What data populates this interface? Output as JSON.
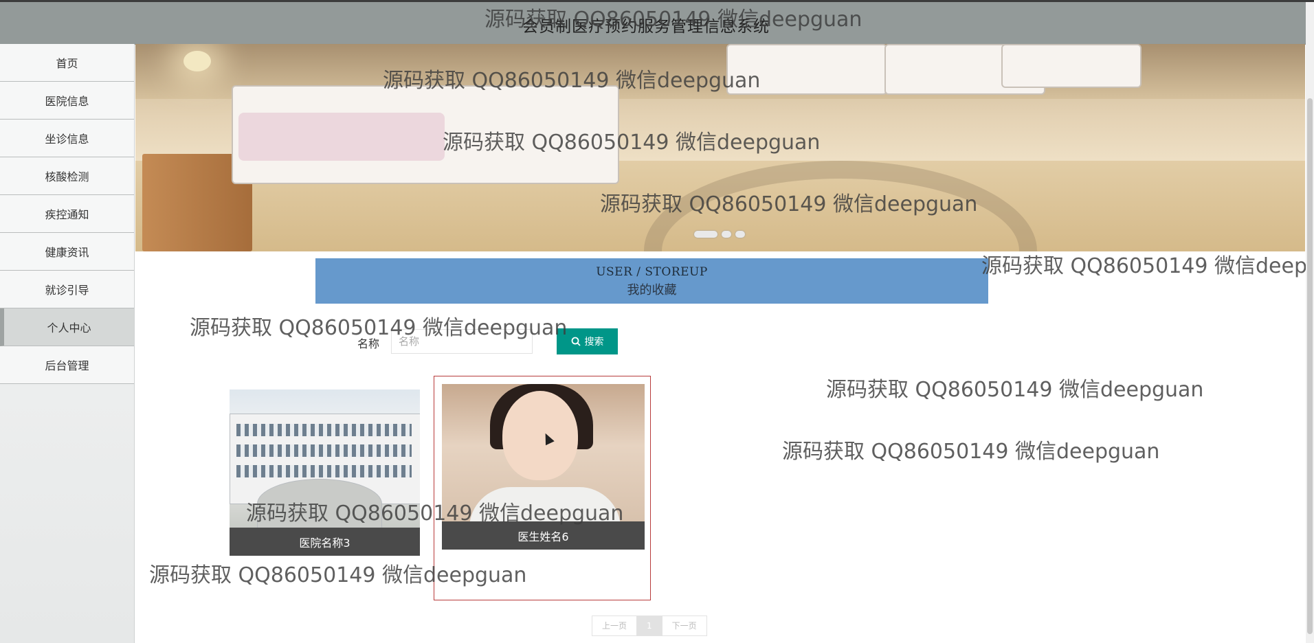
{
  "header": {
    "title": "会员制医疗预约服务管理信息系统"
  },
  "sidebar": {
    "items": [
      {
        "label": "首页"
      },
      {
        "label": "医院信息"
      },
      {
        "label": "坐诊信息"
      },
      {
        "label": "核酸检测"
      },
      {
        "label": "疾控通知"
      },
      {
        "label": "健康资讯"
      },
      {
        "label": "就诊引导"
      },
      {
        "label": "个人中心",
        "active": true
      },
      {
        "label": "后台管理"
      }
    ]
  },
  "banner": {
    "slides": 3,
    "active_slide": 1
  },
  "section": {
    "title_en": "USER / STOREUP",
    "title_cn": "我的收藏"
  },
  "search": {
    "label": "名称",
    "placeholder": "名称",
    "value": "",
    "button_label": "搜索"
  },
  "cards": [
    {
      "caption": "医院名称3"
    },
    {
      "caption": "医生姓名6"
    }
  ],
  "pagination": {
    "prev": "上一页",
    "current": "1",
    "next": "下一页"
  },
  "watermark": {
    "text": "源码获取 QQ86050149 微信deepguan"
  },
  "colors": {
    "header_bg": "#939a99",
    "section_bar": "#6699cc",
    "search_button": "#009688",
    "card_caption": "#4a4a4a",
    "card_hover_border": "#b73a3a"
  }
}
